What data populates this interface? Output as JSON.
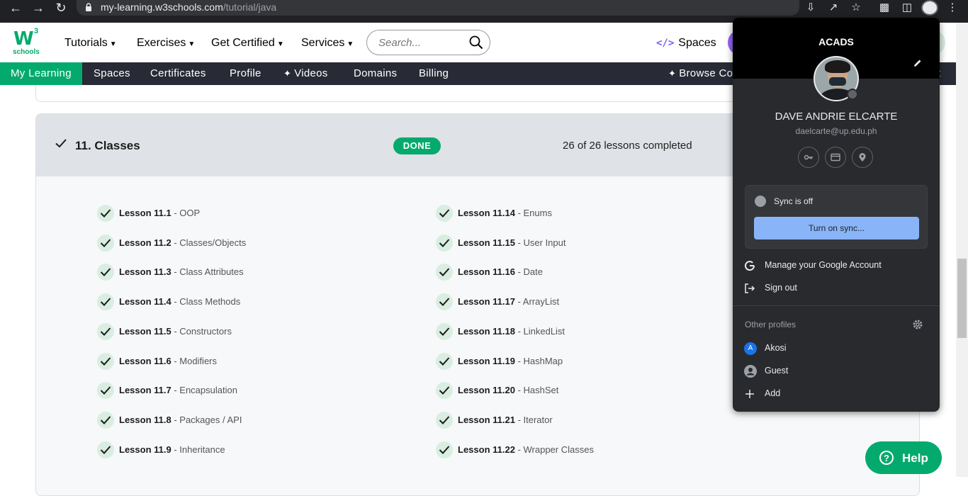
{
  "browser": {
    "url_domain": "my-learning.w3schools.com",
    "url_path": "/tutorial/java"
  },
  "logo": {
    "mark": "W",
    "superscript": "3",
    "sub": "schools"
  },
  "topnav": {
    "items": [
      "Tutorials",
      "Exercises",
      "Get Certified",
      "Services"
    ],
    "search_placeholder": "Search...",
    "spaces_label": "Spaces"
  },
  "subnav": {
    "items": [
      "My Learning",
      "Spaces",
      "Certificates",
      "Profile",
      "Videos",
      "Domains",
      "Billing"
    ],
    "browse_label": "Browse Co",
    "right_fragment": "t"
  },
  "chapter": {
    "title": "11. Classes",
    "status": "DONE",
    "progress": "26 of 26 lessons completed"
  },
  "lessons_left": [
    {
      "num": "Lesson 11.1",
      "name": " - OOP"
    },
    {
      "num": "Lesson 11.2",
      "name": " - Classes/Objects"
    },
    {
      "num": "Lesson 11.3",
      "name": " - Class Attributes"
    },
    {
      "num": "Lesson 11.4",
      "name": " - Class Methods"
    },
    {
      "num": "Lesson 11.5",
      "name": " - Constructors"
    },
    {
      "num": "Lesson 11.6",
      "name": " - Modifiers"
    },
    {
      "num": "Lesson 11.7",
      "name": " - Encapsulation"
    },
    {
      "num": "Lesson 11.8",
      "name": " - Packages / API"
    },
    {
      "num": "Lesson 11.9",
      "name": " - Inheritance"
    }
  ],
  "lessons_right": [
    {
      "num": "Lesson 11.14",
      "name": " - Enums"
    },
    {
      "num": "Lesson 11.15",
      "name": " - User Input"
    },
    {
      "num": "Lesson 11.16",
      "name": " - Date"
    },
    {
      "num": "Lesson 11.17",
      "name": " - ArrayList"
    },
    {
      "num": "Lesson 11.18",
      "name": " - LinkedList"
    },
    {
      "num": "Lesson 11.19",
      "name": " - HashMap"
    },
    {
      "num": "Lesson 11.20",
      "name": " - HashSet"
    },
    {
      "num": "Lesson 11.21",
      "name": " - Iterator"
    },
    {
      "num": "Lesson 11.22",
      "name": " - Wrapper Classes"
    }
  ],
  "profile_popup": {
    "org": "ACADS",
    "name": "DAVE ANDRIE ELCARTE",
    "email": "daelcarte@up.edu.ph",
    "sync_status": "Sync is off",
    "sync_button": "Turn on sync...",
    "manage_account": "Manage your Google Account",
    "sign_out": "Sign out",
    "other_profiles_title": "Other profiles",
    "other_profiles": [
      {
        "name": "Akosi",
        "initial": "A",
        "color": "#1a73e8"
      },
      {
        "name": "Guest"
      },
      {
        "name": "Add"
      }
    ]
  },
  "help_button": "Help",
  "colors": {
    "brand_green": "#04aa6d",
    "nav_dark": "#282a35",
    "popup_bg": "#292a2d",
    "sync_blue": "#8ab4f8"
  }
}
